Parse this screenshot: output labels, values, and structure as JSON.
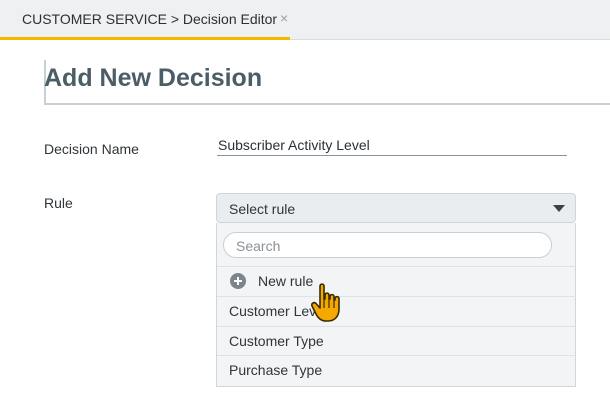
{
  "tab": {
    "label": "CUSTOMER SERVICE > Decision Editor",
    "close": "×"
  },
  "page": {
    "title": "Add New Decision"
  },
  "form": {
    "decision_name_label": "Decision Name",
    "decision_name_value": "Subscriber Activity Level",
    "rule_label": "Rule",
    "rule_select_value": "Select rule"
  },
  "dropdown": {
    "search_placeholder": "Search",
    "new_rule_label": "New rule",
    "options": [
      "Customer Level",
      "Customer Type",
      "Purchase Type"
    ]
  },
  "icons": {
    "tab_close": "close-icon",
    "caret": "chevron-down-icon",
    "new_rule": "plus-circle-icon",
    "cursor": "hand-pointer-icon"
  },
  "colors": {
    "tab_accent": "#f5b800",
    "title": "#4b5d66",
    "cursor": "#f5a800"
  }
}
